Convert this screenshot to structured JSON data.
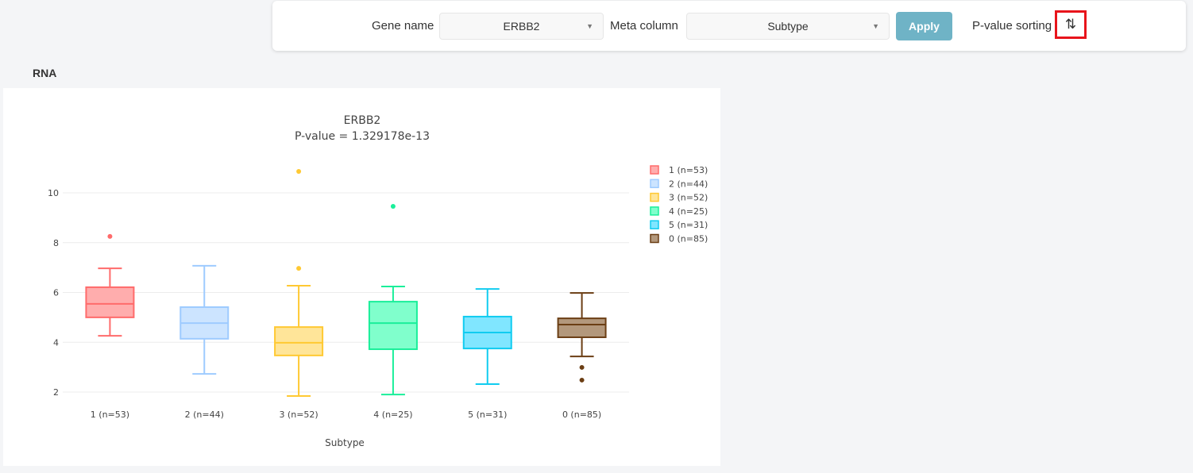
{
  "toolbar": {
    "gene_label": "Gene name",
    "gene_value": "ERBB2",
    "meta_label": "Meta column",
    "meta_value": "Subtype",
    "apply_label": "Apply",
    "sort_label": "P-value sorting",
    "sort_icon": "sort-arrows-icon"
  },
  "section_title": "RNA",
  "chart_data": {
    "type": "box",
    "title": "ERBB2",
    "subtitle": "P-value = 1.329178e-13",
    "xlabel": "Subtype",
    "ylabel": "",
    "ylim": [
      1.5,
      11.2
    ],
    "yticks": [
      2,
      4,
      6,
      8,
      10
    ],
    "grid": true,
    "legend_position": "top-right",
    "categories": [
      "1 (n=53)",
      "2 (n=44)",
      "3 (n=52)",
      "4 (n=25)",
      "5 (n=31)",
      "0 (n=85)"
    ],
    "series": [
      {
        "name": "1 (n=53)",
        "color": "#ff6b6b",
        "fill": "#ffadad",
        "min": 4.26,
        "q1": 5.0,
        "median": 5.54,
        "q3": 6.21,
        "max": 6.97,
        "outliers": [
          8.25
        ]
      },
      {
        "name": "2 (n=44)",
        "color": "#9ecbff",
        "fill": "#cce4ff",
        "min": 2.73,
        "q1": 4.14,
        "median": 4.77,
        "q3": 5.41,
        "max": 7.07,
        "outliers": []
      },
      {
        "name": "3 (n=52)",
        "color": "#ffc933",
        "fill": "#ffe599",
        "min": 1.84,
        "q1": 3.47,
        "median": 3.98,
        "q3": 4.61,
        "max": 6.27,
        "outliers": [
          6.97,
          10.86
        ]
      },
      {
        "name": "4 (n=25)",
        "color": "#1aef9a",
        "fill": "#80ffcc",
        "min": 1.9,
        "q1": 3.72,
        "median": 4.77,
        "q3": 5.63,
        "max": 6.24,
        "outliers": [
          9.46
        ]
      },
      {
        "name": "5 (n=31)",
        "color": "#10ccf0",
        "fill": "#80e6ff",
        "min": 2.32,
        "q1": 3.75,
        "median": 4.39,
        "q3": 5.03,
        "max": 6.14,
        "outliers": []
      },
      {
        "name": "0 (n=85)",
        "color": "#6b3e14",
        "fill": "#b3987c",
        "min": 3.43,
        "q1": 4.2,
        "median": 4.71,
        "q3": 4.96,
        "max": 5.98,
        "outliers": [
          2.99,
          2.48
        ]
      }
    ]
  }
}
